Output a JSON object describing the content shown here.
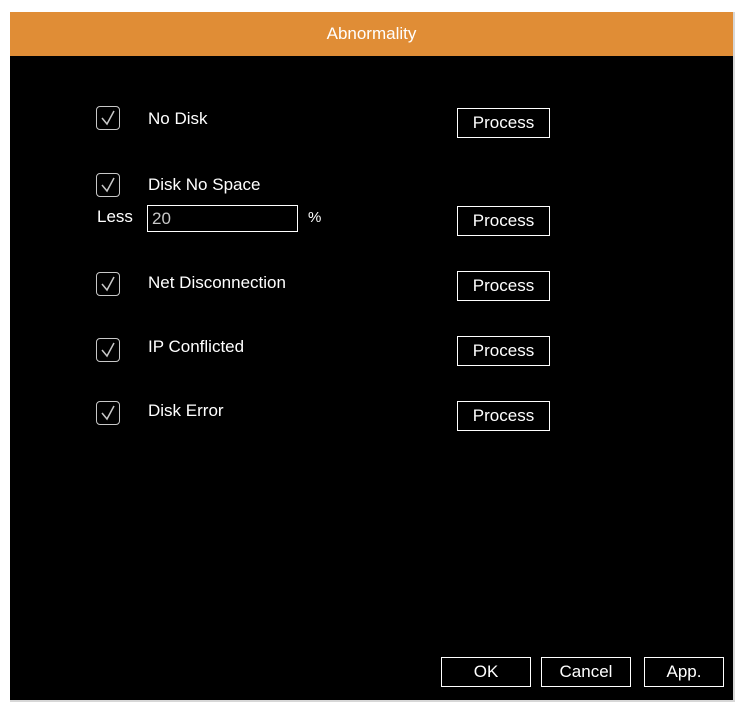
{
  "window": {
    "title": "Abnormality"
  },
  "items": [
    {
      "label": "No Disk",
      "checked": true,
      "process_label": "Process"
    },
    {
      "label": "Disk No Space",
      "checked": true,
      "process_label": "Process"
    },
    {
      "label": "Net Disconnection",
      "checked": true,
      "process_label": "Process"
    },
    {
      "label": "IP Conflicted",
      "checked": true,
      "process_label": "Process"
    },
    {
      "label": "Disk Error",
      "checked": true,
      "process_label": "Process"
    }
  ],
  "disk_space": {
    "less_label": "Less",
    "value": "20",
    "unit": "%"
  },
  "footer": {
    "ok_label": "OK",
    "cancel_label": "Cancel",
    "apply_label": "App."
  },
  "colors": {
    "titlebar": "#e08d36",
    "background": "#000000",
    "text": "#ffffff"
  }
}
